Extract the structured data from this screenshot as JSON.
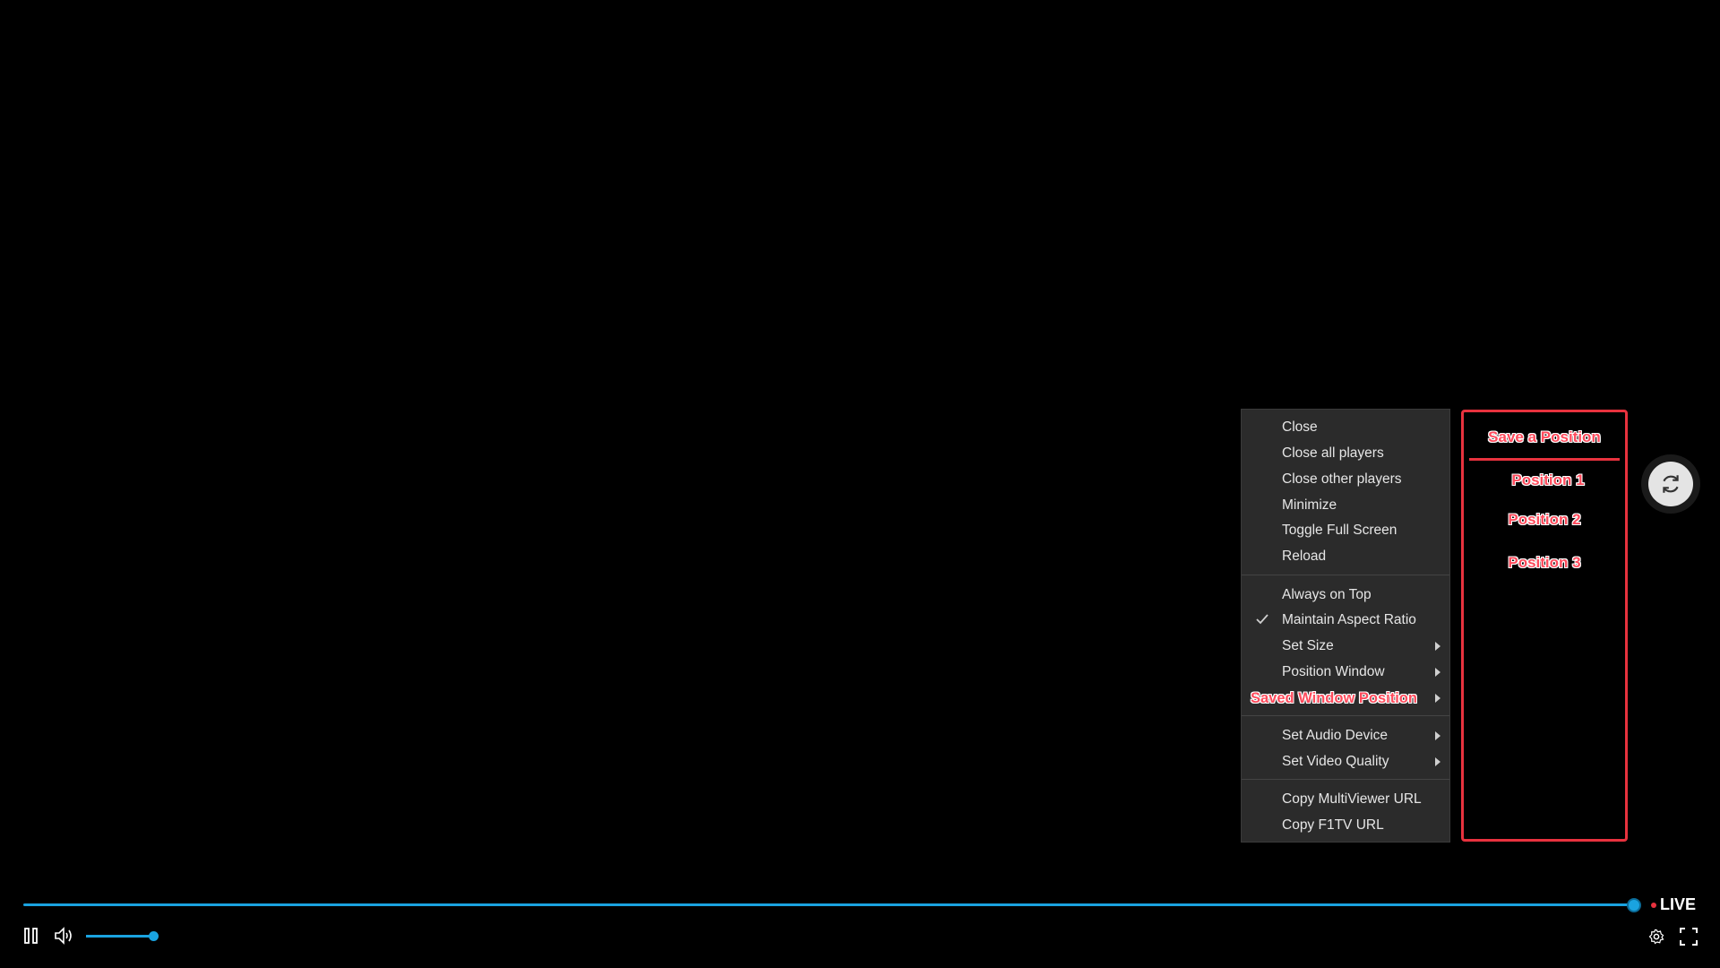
{
  "context_menu": {
    "group1": [
      "Close",
      "Close all players",
      "Close other players",
      "Minimize",
      "Toggle Full Screen",
      "Reload"
    ],
    "always_on_top": "Always on Top",
    "maintain_aspect_ratio": "Maintain Aspect Ratio",
    "maintain_aspect_ratio_checked": true,
    "set_size": "Set Size",
    "position_window": "Position Window",
    "saved_window_position": "Saved Window Position",
    "set_audio_device": "Set Audio Device",
    "set_video_quality": "Set Video Quality",
    "copy_multiviewer_url": "Copy MultiViewer URL",
    "copy_f1tv_url": "Copy F1TV URL"
  },
  "saved_position_submenu": {
    "save": "Save a Position",
    "positions": [
      "Position 1",
      "Position 2",
      "Position 3"
    ]
  },
  "player": {
    "live_label": "LIVE",
    "seek_progress": 1.0,
    "volume_level": 0.85
  },
  "icons": {
    "sync": "sync-icon",
    "pause": "pause-icon",
    "volume": "volume-icon",
    "settings": "gear-icon",
    "fullscreen": "fullscreen-icon"
  },
  "colors": {
    "accent": "#1aa3e0",
    "highlight": "#e8323e",
    "menu_bg": "#2b2b2b"
  }
}
